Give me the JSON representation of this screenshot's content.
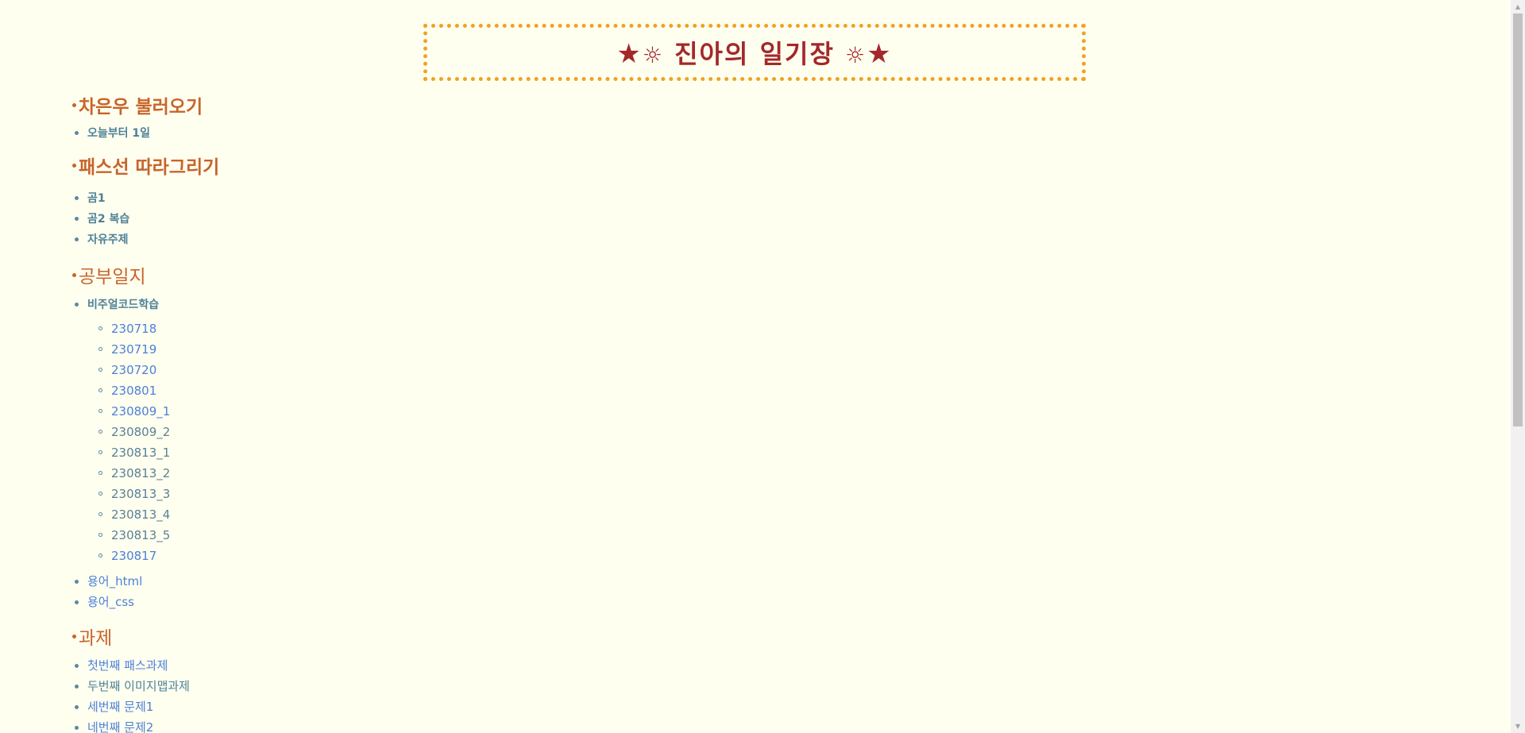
{
  "banner": {
    "left_star": "★",
    "left_sun": "☼",
    "title": "진아의 일기장",
    "right_sun": "☼",
    "right_star": "★"
  },
  "sections": [
    {
      "title": "차은우 불러오기",
      "items": [
        {
          "label": "오늘부터 1일"
        }
      ]
    },
    {
      "title": "패스선 따라그리기",
      "items": [
        {
          "label": "곰1"
        },
        {
          "label": "곰2 복습"
        },
        {
          "label": "자유주제"
        }
      ]
    },
    {
      "title": "공부일지",
      "items": [
        {
          "label": "비주얼코드학습",
          "sub": [
            "230718",
            "230719",
            "230720",
            "230801",
            "230809_1",
            "230809_2",
            "230813_1",
            "230813_2",
            "230813_3",
            "230813_4",
            "230813_5",
            "230817"
          ]
        },
        {
          "label": "용어_html"
        },
        {
          "label": "용어_css"
        }
      ]
    },
    {
      "title": "과제",
      "items": [
        {
          "label": "첫번째 패스과제"
        },
        {
          "label": "두번째 이미지맵과제"
        },
        {
          "label": "세번째 문제1"
        },
        {
          "label": "네번째 문제2"
        }
      ]
    }
  ],
  "colors": {
    "background": "#fffff0",
    "banner_border": "#f2a122",
    "banner_text": "#a3282a",
    "section_title": "#c8642a",
    "link_teal": "#4d8197",
    "link_blue": "#4c80d8"
  }
}
